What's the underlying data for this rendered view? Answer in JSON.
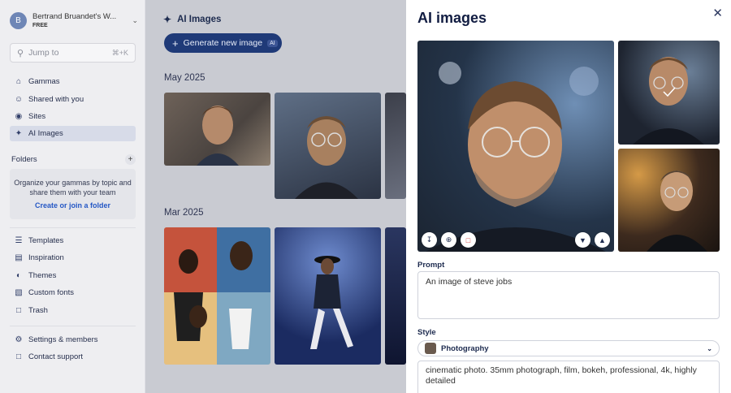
{
  "workspace": {
    "initial": "B",
    "name": "Bertrand Bruandet's W...",
    "plan": "FREE"
  },
  "search": {
    "placeholder": "Jump to",
    "shortcut": "⌘+K"
  },
  "nav": [
    {
      "label": "Gammas",
      "icon": "home-icon"
    },
    {
      "label": "Shared with you",
      "icon": "users-icon"
    },
    {
      "label": "Sites",
      "icon": "globe-icon"
    },
    {
      "label": "AI Images",
      "icon": "sparkle-icon"
    }
  ],
  "folders": {
    "title": "Folders",
    "empty_text": "Organize your gammas by topic and share them with your team",
    "link": "Create or join a folder"
  },
  "nav2": [
    {
      "label": "Templates",
      "icon": "templates-icon"
    },
    {
      "label": "Inspiration",
      "icon": "book-icon"
    },
    {
      "label": "Themes",
      "icon": "palette-icon"
    },
    {
      "label": "Custom fonts",
      "icon": "font-icon"
    },
    {
      "label": "Trash",
      "icon": "trash-icon"
    }
  ],
  "nav3": [
    {
      "label": "Settings & members",
      "icon": "settings-icon"
    },
    {
      "label": "Contact support",
      "icon": "chat-icon"
    }
  ],
  "main": {
    "title": "AI Images",
    "generate_label": "Generate new image",
    "ai_badge": "AI",
    "months": [
      "May 2025",
      "Mar 2025"
    ]
  },
  "panel": {
    "title": "AI images",
    "prompt_label": "Prompt",
    "prompt_value": "An image of steve jobs",
    "style_label": "Style",
    "style_value": "Photography",
    "style_prompt": "cinematic photo. 35mm photograph, film, bokeh, professional, 4k, highly detailed"
  },
  "colors": {
    "accent": "#1f3a78",
    "active_nav": "#d7dbe8",
    "link": "#2457c5"
  }
}
